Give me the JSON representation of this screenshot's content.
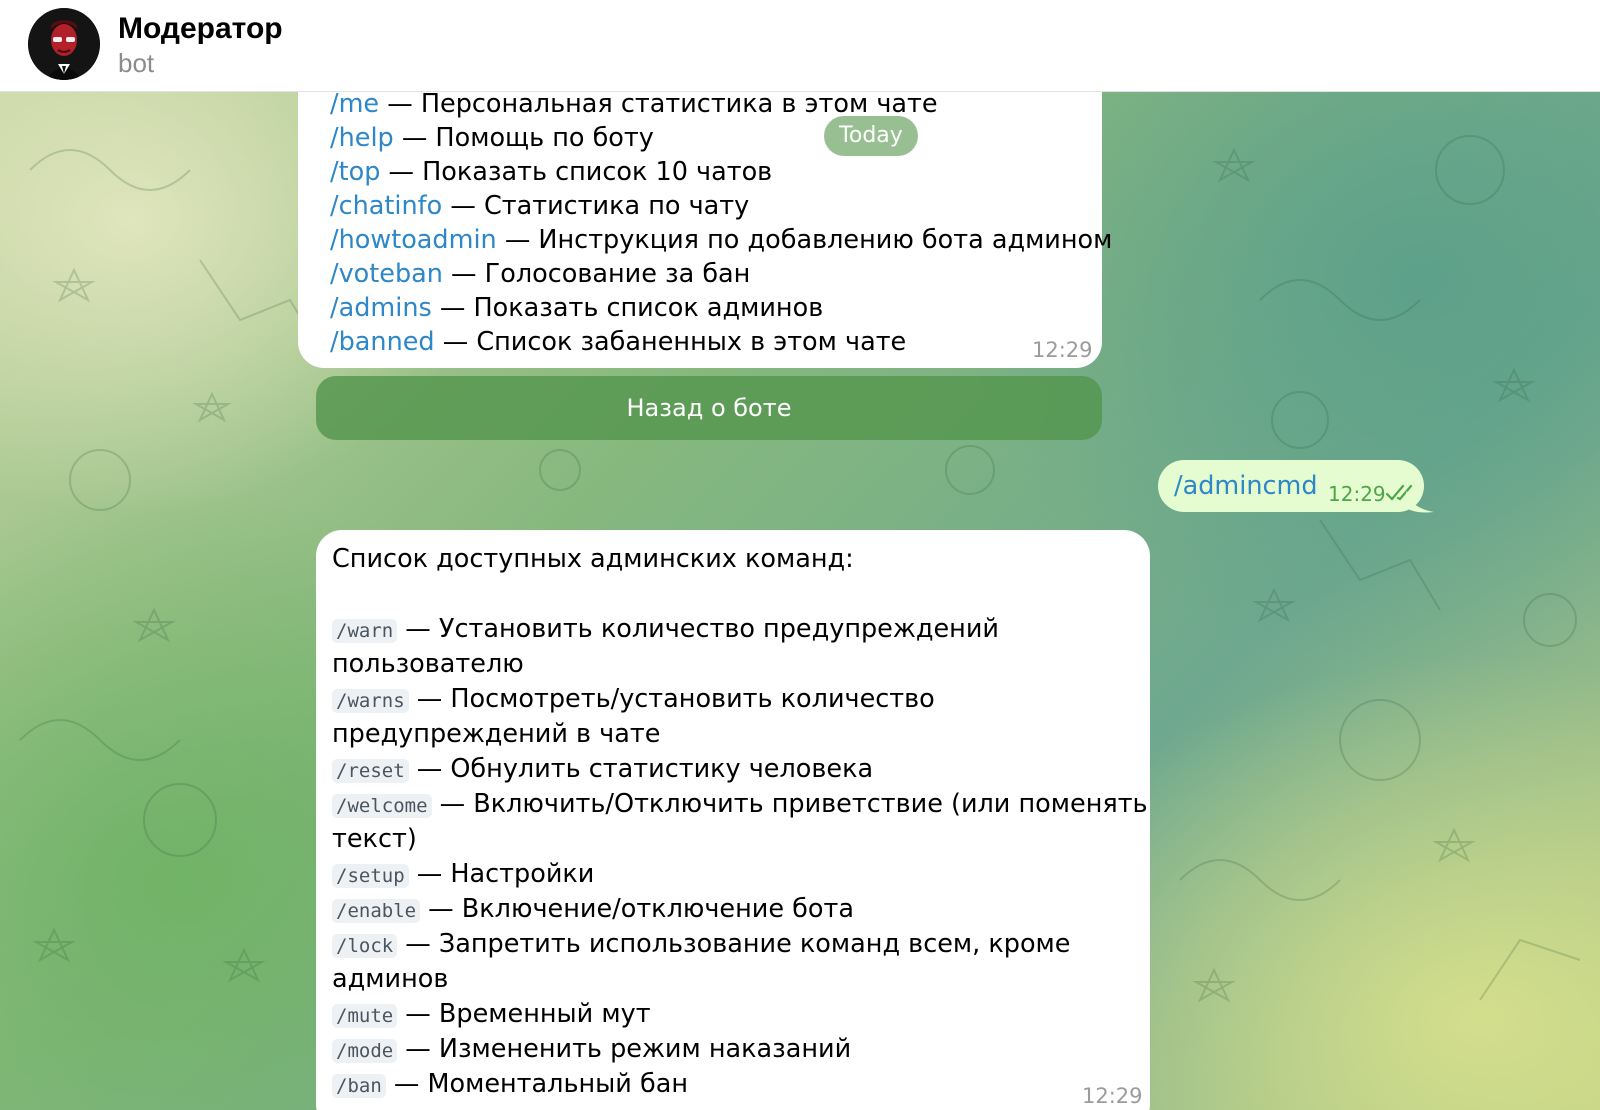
{
  "header": {
    "title": "Модератор",
    "subtitle": "bot",
    "avatar_icon": "masked-figure-avatar-icon"
  },
  "date_separator": "Today",
  "messages": [
    {
      "direction": "incoming",
      "time": "12:29",
      "commands": [
        {
          "cmd": "/me",
          "desc": " — Персональная статистика в этом чате"
        },
        {
          "cmd": "/help",
          "desc": " — Помощь по боту"
        },
        {
          "cmd": "/top",
          "desc": " — Показать список 10 чатов"
        },
        {
          "cmd": "/chatinfo",
          "desc": " — Статистика по чату"
        },
        {
          "cmd": "/howtoadmin",
          "desc": " — Инструкция по добавлению бота админом"
        },
        {
          "cmd": "/voteban",
          "desc": " — Голосование за бан"
        },
        {
          "cmd": "/admins",
          "desc": " — Показать список админов"
        },
        {
          "cmd": "/banned",
          "desc": " — Список забаненных в этом чате"
        }
      ],
      "inline_button": "Назад о боте"
    },
    {
      "direction": "outgoing",
      "text": "/admincmd",
      "time": "12:29",
      "status_icon": "double-check-icon"
    },
    {
      "direction": "incoming",
      "time": "12:29",
      "title": "Список доступных админских команд:",
      "commands": [
        {
          "cmd": "/warn",
          "desc": " — Установить количество предупреждений",
          "cont": "пользователю"
        },
        {
          "cmd": "/warns",
          "desc": " — Посмотреть/установить количество",
          "cont": "предупреждений в чате"
        },
        {
          "cmd": "/reset",
          "desc": " — Обнулить статистику человека"
        },
        {
          "cmd": "/welcome",
          "desc": " — Включить/Отключить приветствие (или поменять",
          "cont": "текст)"
        },
        {
          "cmd": "/setup",
          "desc": " — Настройки"
        },
        {
          "cmd": "/enable",
          "desc": " — Включение/отключение бота"
        },
        {
          "cmd": "/lock",
          "desc": " — Запретить использование команд всем, кроме",
          "cont": "админов"
        },
        {
          "cmd": "/mute",
          "desc": " — Временный мут"
        },
        {
          "cmd": "/mode",
          "desc": " — Измененить режим наказаний"
        },
        {
          "cmd": "/ban",
          "desc": " — Моментальный бан"
        }
      ]
    }
  ],
  "colors": {
    "link": "#2e87c8",
    "outgoing_bubble": "#e4fccf",
    "inline_button": "#54964e",
    "read_check": "#4fa44a"
  }
}
